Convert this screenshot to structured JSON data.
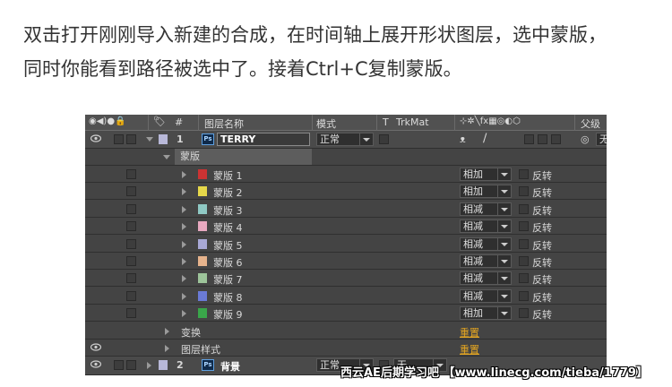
{
  "intro": {
    "line1": "双击打开刚刚导入新建的合成，在时间轴上展开形状图层，选中蒙版，",
    "line2": "同时你能看到路径被选中了。接着Ctrl+C复制蒙版。"
  },
  "header": {
    "switch_icons": "◉◀)●🔒",
    "num": "#",
    "name": "图层名称",
    "mode": "模式",
    "t": "T",
    "trkmat": "TrkMat",
    "fx_icons": "⊹✲╲fx▦◎◐⬡",
    "parent": "父级"
  },
  "layer1": {
    "num": "1",
    "badge": "Ps",
    "name": "TERRY",
    "mode": "正常",
    "parent_value": "无"
  },
  "masks_group": {
    "label": "蒙版"
  },
  "masks": [
    {
      "name": "蒙版 1",
      "color": "#cc3333",
      "mode": "相加",
      "invert": "反转"
    },
    {
      "name": "蒙版 2",
      "color": "#e6d84a",
      "mode": "相加",
      "invert": "反转"
    },
    {
      "name": "蒙版 3",
      "color": "#8fc9c4",
      "mode": "相减",
      "invert": "反转"
    },
    {
      "name": "蒙版 4",
      "color": "#e8a9c0",
      "mode": "相减",
      "invert": "反转"
    },
    {
      "name": "蒙版 5",
      "color": "#a9a9d6",
      "mode": "相减",
      "invert": "反转"
    },
    {
      "name": "蒙版 6",
      "color": "#e6b38c",
      "mode": "相减",
      "invert": "反转"
    },
    {
      "name": "蒙版 7",
      "color": "#9dc49a",
      "mode": "相减",
      "invert": "反转"
    },
    {
      "name": "蒙版 8",
      "color": "#6a7ad6",
      "mode": "相减",
      "invert": "反转"
    },
    {
      "name": "蒙版 9",
      "color": "#3aa64a",
      "mode": "相加",
      "invert": "反转"
    }
  ],
  "transform": {
    "label": "变换",
    "reset": "重置"
  },
  "layer_styles": {
    "label": "图层样式",
    "reset": "重置"
  },
  "layer2": {
    "num": "2",
    "badge": "Ps",
    "name": "背景",
    "mode": "正常",
    "trk": "无"
  },
  "watermark": "西云AE后期学习吧 【www.linecg.com/tieba/1779】"
}
